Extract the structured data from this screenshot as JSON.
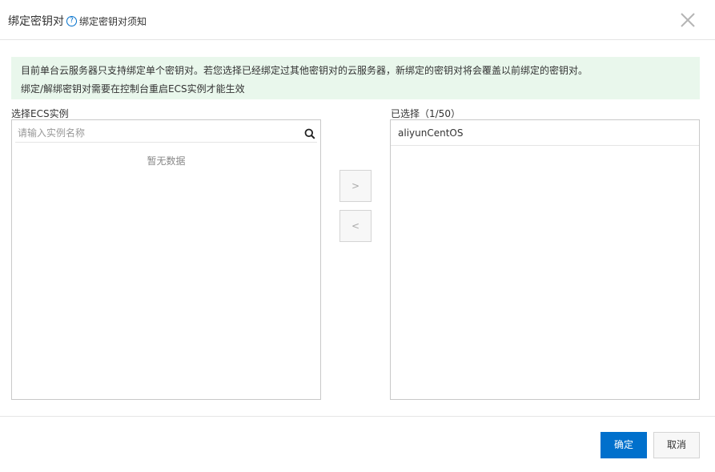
{
  "dialog": {
    "title": "绑定密钥对",
    "help_icon_glyph": "?",
    "help_link": "绑定密钥对须知",
    "close_icon": "close-icon"
  },
  "notice": {
    "line1": "目前单台云服务器只支持绑定单个密钥对。若您选择已经绑定过其他密钥对的云服务器，新绑定的密钥对将会覆盖以前绑定的密钥对。",
    "line2": "绑定/解绑密钥对需要在控制台重启ECS实例才能生效",
    "background_color": "#e9f7ec"
  },
  "left_panel": {
    "label": "选择ECS实例",
    "search_placeholder": "请输入实例名称",
    "search_value": "",
    "search_icon": "search-icon",
    "empty_text": "暂无数据"
  },
  "right_panel": {
    "label": "已选择（1/50）",
    "items": [
      "aliyunCentOS"
    ]
  },
  "transfer": {
    "move_right": ">",
    "move_left": "<"
  },
  "footer": {
    "confirm": "确定",
    "cancel": "取消"
  },
  "colors": {
    "primary": "#0070cc",
    "border": "#c9c9c9"
  }
}
